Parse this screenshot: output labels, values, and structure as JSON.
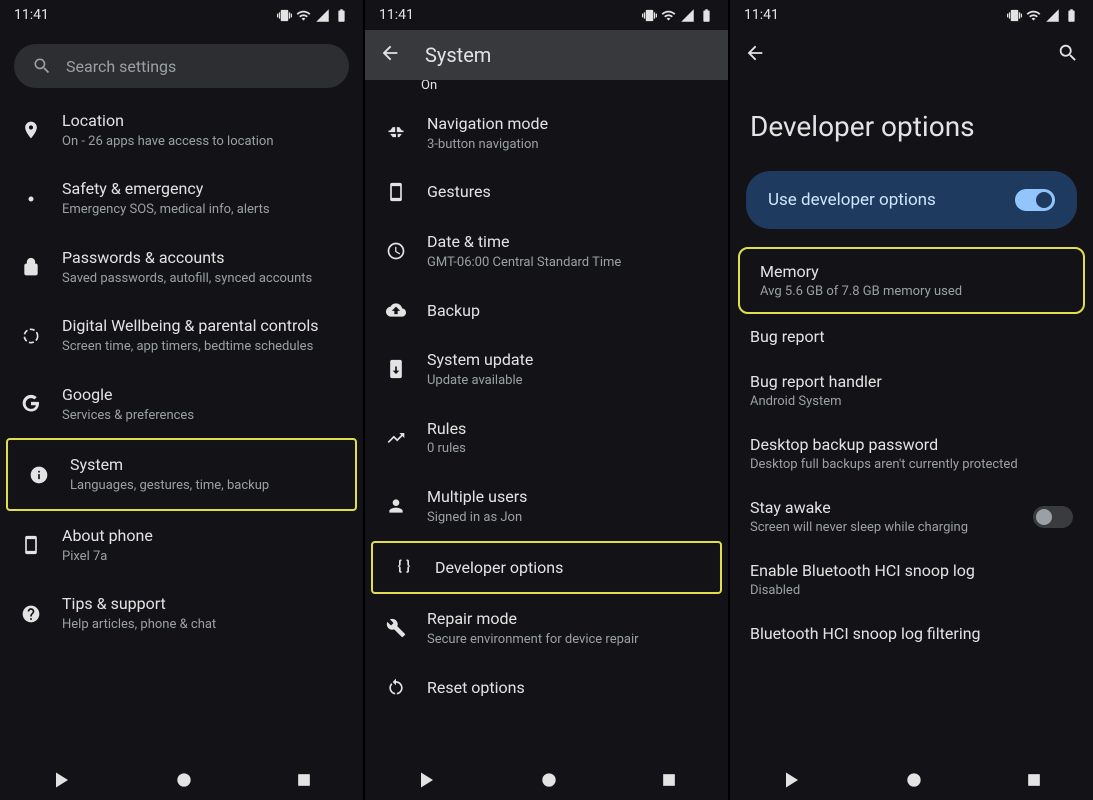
{
  "status": {
    "time": "11:41"
  },
  "screen1": {
    "search_placeholder": "Search settings",
    "items": [
      {
        "title": "Location",
        "subtitle": "On - 26 apps have access to location"
      },
      {
        "title": "Safety & emergency",
        "subtitle": "Emergency SOS, medical info, alerts"
      },
      {
        "title": "Passwords & accounts",
        "subtitle": "Saved passwords, autofill, synced accounts"
      },
      {
        "title": "Digital Wellbeing & parental controls",
        "subtitle": "Screen time, app timers, bedtime schedules"
      },
      {
        "title": "Google",
        "subtitle": "Services & preferences"
      },
      {
        "title": "System",
        "subtitle": "Languages, gestures, time, backup"
      },
      {
        "title": "About phone",
        "subtitle": "Pixel 7a"
      },
      {
        "title": "Tips & support",
        "subtitle": "Help articles, phone & chat"
      }
    ]
  },
  "screen2": {
    "title": "System",
    "partial_top": "On",
    "items": [
      {
        "title": "Navigation mode",
        "subtitle": "3-button navigation"
      },
      {
        "title": "Gestures"
      },
      {
        "title": "Date & time",
        "subtitle": "GMT-06:00 Central Standard Time"
      },
      {
        "title": "Backup"
      },
      {
        "title": "System update",
        "subtitle": "Update available"
      },
      {
        "title": "Rules",
        "subtitle": "0 rules"
      },
      {
        "title": "Multiple users",
        "subtitle": "Signed in as Jon"
      },
      {
        "title": "Developer options"
      },
      {
        "title": "Repair mode",
        "subtitle": "Secure environment for device repair"
      },
      {
        "title": "Reset options"
      }
    ]
  },
  "screen3": {
    "title": "Developer options",
    "toggle_label": "Use developer options",
    "items": [
      {
        "title": "Memory",
        "subtitle": "Avg 5.6 GB of 7.8 GB memory used"
      },
      {
        "title": "Bug report"
      },
      {
        "title": "Bug report handler",
        "subtitle": "Android System"
      },
      {
        "title": "Desktop backup password",
        "subtitle": "Desktop full backups aren't currently protected"
      },
      {
        "title": "Stay awake",
        "subtitle": "Screen will never sleep while charging"
      },
      {
        "title": "Enable Bluetooth HCI snoop log",
        "subtitle": "Disabled"
      },
      {
        "title": "Bluetooth HCI snoop log filtering"
      }
    ]
  }
}
